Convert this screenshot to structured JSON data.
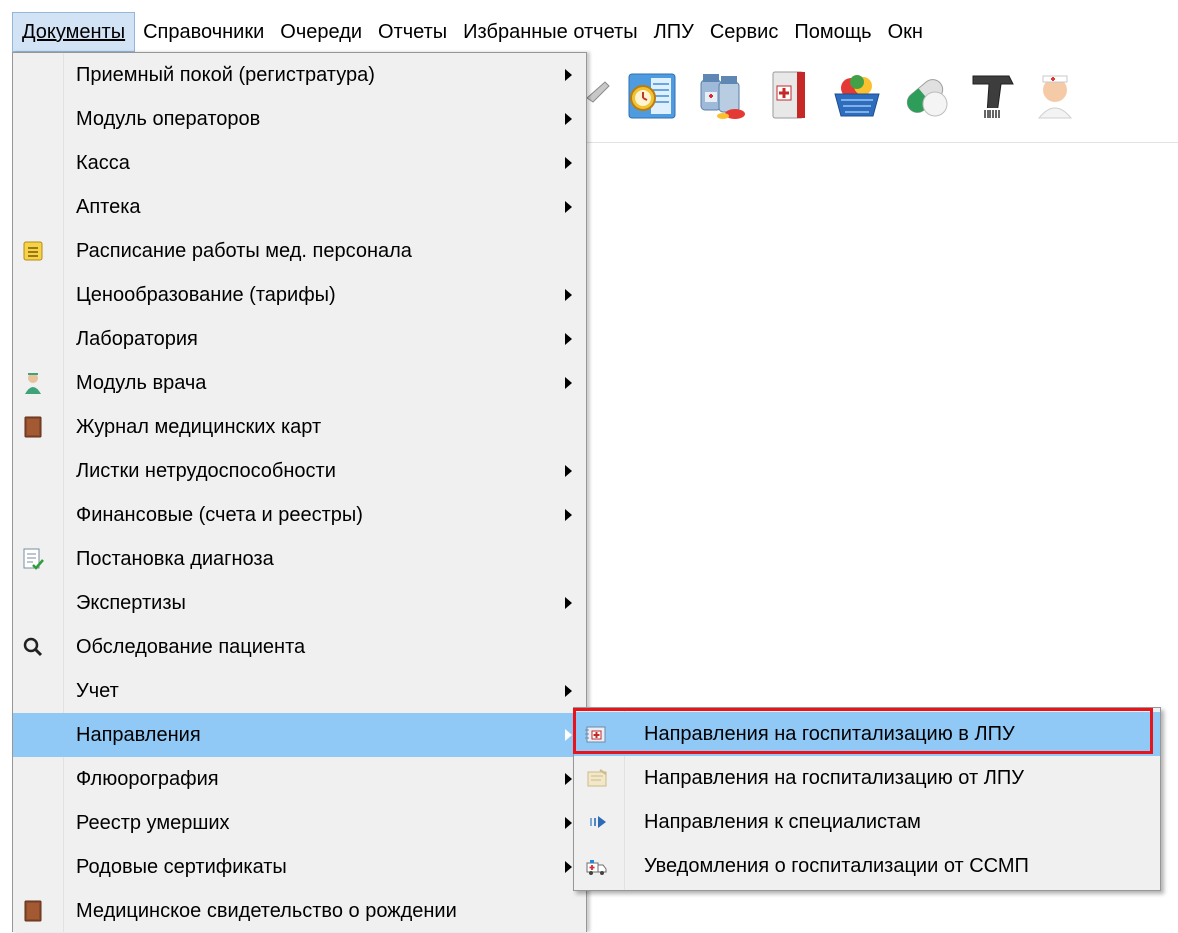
{
  "menubar": {
    "items": [
      "Документы",
      "Справочники",
      "Очереди",
      "Отчеты",
      "Избранные отчеты",
      "ЛПУ",
      "Сервис",
      "Помощь",
      "Окн"
    ]
  },
  "toolbar": {
    "icons": [
      "journal-clock-icon",
      "medicine-bottles-icon",
      "medical-folder-icon",
      "basket-pills-icon",
      "capsule-icon",
      "barcode-scanner-icon",
      "nurse-icon"
    ]
  },
  "documents_menu": {
    "items": [
      {
        "label": "Приемный покой (регистратура)",
        "submenu": true,
        "icon": ""
      },
      {
        "label": "Модуль операторов",
        "submenu": true,
        "icon": ""
      },
      {
        "label": "Касса",
        "submenu": true,
        "icon": ""
      },
      {
        "label": "Аптека",
        "submenu": true,
        "icon": ""
      },
      {
        "label": "Расписание работы мед. персонала",
        "submenu": false,
        "icon": "schedule-icon"
      },
      {
        "label": "Ценообразование (тарифы)",
        "submenu": true,
        "icon": ""
      },
      {
        "label": "Лаборатория",
        "submenu": true,
        "icon": ""
      },
      {
        "label": "Модуль врача",
        "submenu": true,
        "icon": "doctor-icon"
      },
      {
        "label": "Журнал медицинских карт",
        "submenu": false,
        "icon": "book-icon"
      },
      {
        "label": "Листки нетрудоспособности",
        "submenu": true,
        "icon": ""
      },
      {
        "label": "Финансовые (счета и реестры)",
        "submenu": true,
        "icon": ""
      },
      {
        "label": "Постановка диагноза",
        "submenu": false,
        "icon": "diagnosis-icon"
      },
      {
        "label": "Экспертизы",
        "submenu": true,
        "icon": ""
      },
      {
        "label": "Обследование пациента",
        "submenu": false,
        "icon": "search-icon"
      },
      {
        "label": "Учет",
        "submenu": true,
        "icon": ""
      },
      {
        "label": "Направления",
        "submenu": true,
        "icon": ""
      },
      {
        "label": "Флюорография",
        "submenu": true,
        "icon": ""
      },
      {
        "label": "Реестр умерших",
        "submenu": true,
        "icon": ""
      },
      {
        "label": "Родовые сертификаты",
        "submenu": true,
        "icon": ""
      },
      {
        "label": "Медицинское свидетельство о рождении",
        "submenu": false,
        "icon": "book-icon"
      }
    ],
    "highlighted_index": 15
  },
  "referrals_submenu": {
    "items": [
      {
        "label": "Направления на госпитализацию в ЛПУ",
        "icon": "hospital-referral-in-icon"
      },
      {
        "label": "Направления на госпитализацию от ЛПУ",
        "icon": "hospital-referral-out-icon"
      },
      {
        "label": "Направления к специалистам",
        "icon": "specialist-arrow-icon"
      },
      {
        "label": "Уведомления о госпитализации от ССМП",
        "icon": "ambulance-icon"
      }
    ],
    "highlighted_index": 0
  },
  "colors": {
    "menu_bg": "#f0f0f0",
    "highlight": "#90c8f6",
    "callout_frame": "#e8141c"
  }
}
